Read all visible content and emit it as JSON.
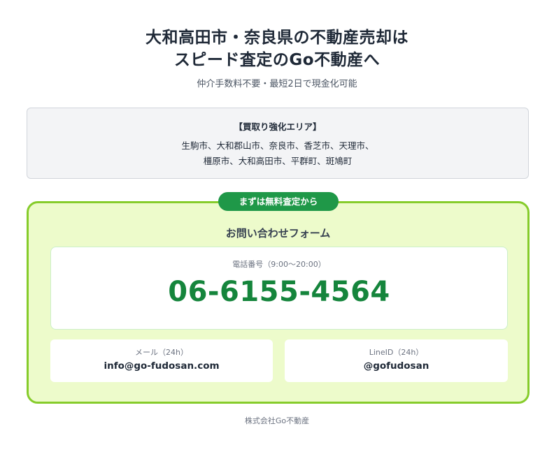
{
  "hero": {
    "headline_line1": "大和高田市・奈良県の不動産売却は",
    "headline_line2": "スピード査定のGo不動産へ",
    "subline": "仲介手数料不要・最短2日で現金化可能"
  },
  "area": {
    "title": "【買取り強化エリア】",
    "line1": "生駒市、大和郡山市、奈良市、香芝市、天理市、",
    "line2": "橿原市、大和高田市、平群町、斑鳩町"
  },
  "form": {
    "badge": "まずは無料査定から",
    "title": "お問い合わせフォーム",
    "phone": {
      "label": "電話番号（9:00〜20:00）",
      "number": "06-6155-4564"
    },
    "mail": {
      "label": "メール（24h）",
      "value": "info@go-fudosan.com"
    },
    "line": {
      "label": "LineID（24h）",
      "value": "@gofudosan"
    }
  },
  "footer": {
    "company": "株式会社Go不動産"
  },
  "colors": {
    "accent_green": "#1f9848",
    "phone_green": "#15853c",
    "form_border": "#86cc2b",
    "form_background": "#edfbcb"
  }
}
